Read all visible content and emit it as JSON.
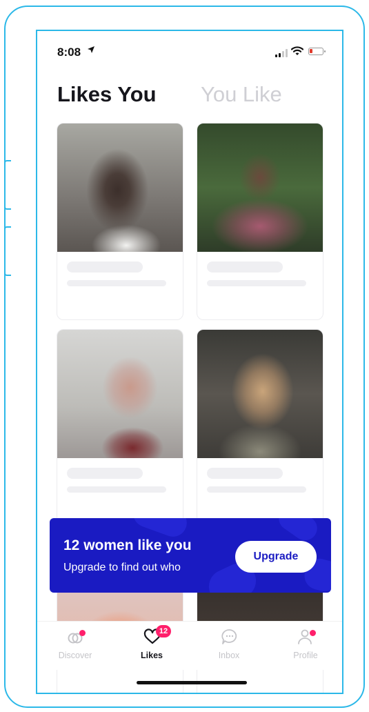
{
  "status_bar": {
    "time": "8:08",
    "location_icon": "location-arrow-icon"
  },
  "tabs": {
    "likes_you": "Likes You",
    "you_like": "You Like"
  },
  "cards": [
    {
      "photo": "blurred-photo-1"
    },
    {
      "photo": "blurred-photo-2"
    },
    {
      "photo": "blurred-photo-3"
    },
    {
      "photo": "blurred-photo-4"
    },
    {
      "photo": "blurred-photo-5"
    },
    {
      "photo": "blurred-photo-6"
    }
  ],
  "banner": {
    "title": "12 women like you",
    "subtitle": "Upgrade to find out who",
    "button_label": "Upgrade"
  },
  "tab_bar": {
    "items": [
      {
        "label": "Discover",
        "icon": "discover-icon"
      },
      {
        "label": "Likes",
        "icon": "heart-icon",
        "badge": "12"
      },
      {
        "label": "Inbox",
        "icon": "chat-bubble-icon"
      },
      {
        "label": "Profile",
        "icon": "profile-icon"
      }
    ]
  },
  "colors": {
    "accent": "#1a1bc2",
    "badge": "#ff1f6b",
    "frame": "#2bb8e8"
  }
}
